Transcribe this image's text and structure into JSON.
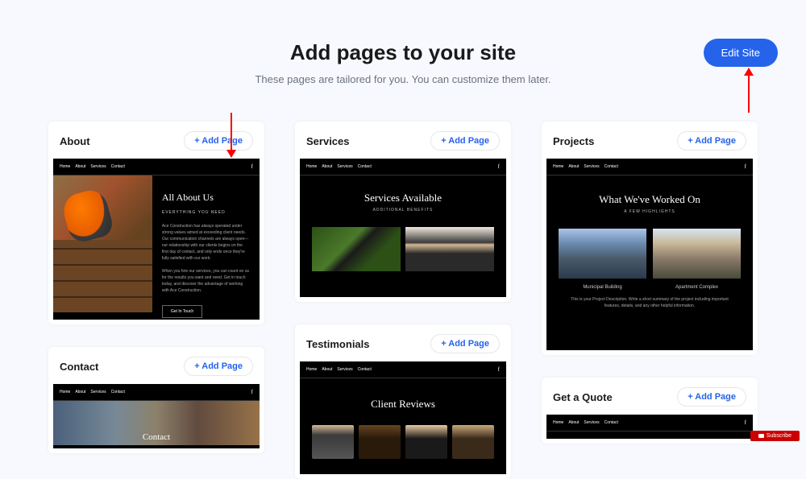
{
  "header": {
    "title": "Add pages to your site",
    "subtitle": "These pages are tailored for you. You can customize them later.",
    "edit_btn": "Edit Site"
  },
  "add_page_label": "+ Add Page",
  "nav_items": [
    "Home",
    "About",
    "Services",
    "Contact"
  ],
  "cards": {
    "about": {
      "title": "About",
      "preview": {
        "heading": "All About Us",
        "sub": "EVERYTHING YOU NEED",
        "button": "Get In Touch"
      }
    },
    "contact": {
      "title": "Contact",
      "preview": {
        "heading": "Contact"
      }
    },
    "services": {
      "title": "Services",
      "preview": {
        "heading": "Services Available",
        "sub": "ADDITIONAL BENEFITS"
      }
    },
    "testimonials": {
      "title": "Testimonials",
      "preview": {
        "heading": "Client Reviews"
      }
    },
    "projects": {
      "title": "Projects",
      "preview": {
        "heading": "What We've Worked On",
        "sub": "A FEW HIGHLIGHTS",
        "caption1": "Municipal Building",
        "caption2": "Apartment Complex"
      }
    },
    "quote": {
      "title": "Get a Quote"
    }
  },
  "subscribe": "Subscribe"
}
